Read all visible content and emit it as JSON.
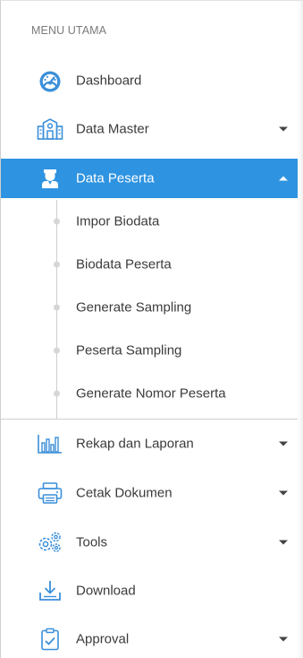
{
  "sidebar": {
    "section_title": "MENU UTAMA",
    "items": [
      {
        "label": "Dashboard",
        "icon": "dashboard-icon",
        "has_caret": false
      },
      {
        "label": "Data Master",
        "icon": "building-icon",
        "has_caret": true
      },
      {
        "label": "Data Peserta",
        "icon": "user-graduate-icon",
        "has_caret": true,
        "expanded": true,
        "children": [
          {
            "label": "Impor Biodata"
          },
          {
            "label": "Biodata Peserta"
          },
          {
            "label": "Generate Sampling"
          },
          {
            "label": "Peserta Sampling"
          },
          {
            "label": "Generate Nomor Peserta"
          }
        ]
      },
      {
        "label": "Rekap dan Laporan",
        "icon": "bar-chart-icon",
        "has_caret": true
      },
      {
        "label": "Cetak Dokumen",
        "icon": "printer-icon",
        "has_caret": true
      },
      {
        "label": "Tools",
        "icon": "gears-icon",
        "has_caret": true
      },
      {
        "label": "Download",
        "icon": "download-icon",
        "has_caret": false
      },
      {
        "label": "Approval",
        "icon": "clipboard-check-icon",
        "has_caret": true
      }
    ]
  },
  "colors": {
    "accent": "#2e93e0",
    "icon_blue": "#3b8fd9",
    "text": "#3b3b3b",
    "muted": "#7b7b7b"
  }
}
